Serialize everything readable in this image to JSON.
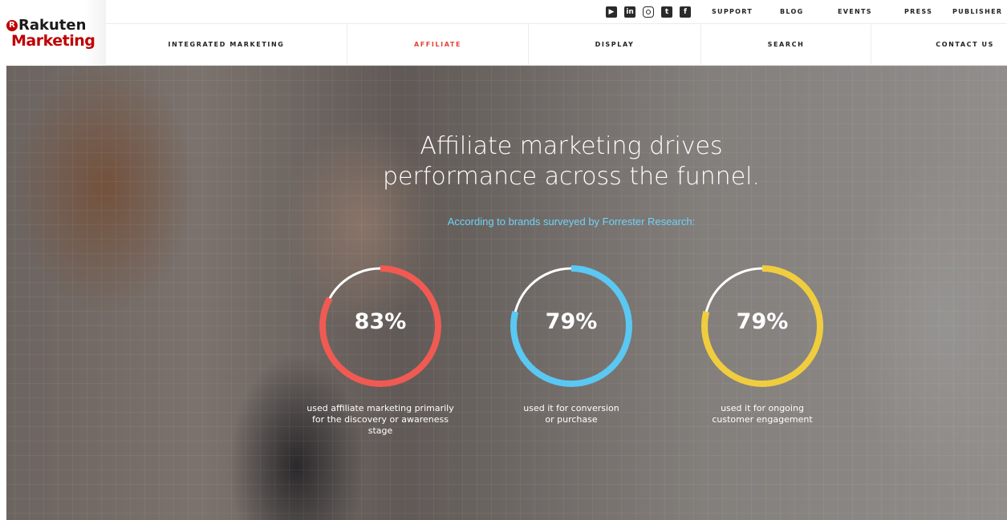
{
  "brand": {
    "logo_top": "Rakuten",
    "logo_bottom": "Marketing",
    "logo_mark": "R"
  },
  "social_icons": [
    "youtube-icon",
    "linkedin-icon",
    "instagram-icon",
    "twitter-icon",
    "facebook-icon"
  ],
  "utility_nav": [
    "SUPPORT",
    "BLOG",
    "EVENTS",
    "PRESS",
    "PUBLISHER"
  ],
  "main_nav": [
    {
      "label": "INTEGRATED MARKETING",
      "active": false
    },
    {
      "label": "AFFILIATE",
      "active": true
    },
    {
      "label": "DISPLAY",
      "active": false
    },
    {
      "label": "SEARCH",
      "active": false
    },
    {
      "label": "CONTACT US",
      "active": false
    }
  ],
  "hero": {
    "headline_line1": "Affiliate marketing drives",
    "headline_line2": "performance across the funnel.",
    "subhead": "According to brands surveyed by Forrester Research:",
    "stats": [
      {
        "value": "83%",
        "percent": 83,
        "color": "#ef5a53",
        "caption": "used affiliate marketing primarily for the discovery or awareness stage"
      },
      {
        "value": "79%",
        "percent": 79,
        "color": "#5ac8f2",
        "caption": "used it for conversion or purchase"
      },
      {
        "value": "79%",
        "percent": 79,
        "color": "#f0cd3e",
        "caption": "used it for ongoing customer engagement"
      }
    ]
  },
  "colors": {
    "brand_red": "#bf0000",
    "active_nav": "#e0443b",
    "subhead": "#6fd3f7"
  }
}
